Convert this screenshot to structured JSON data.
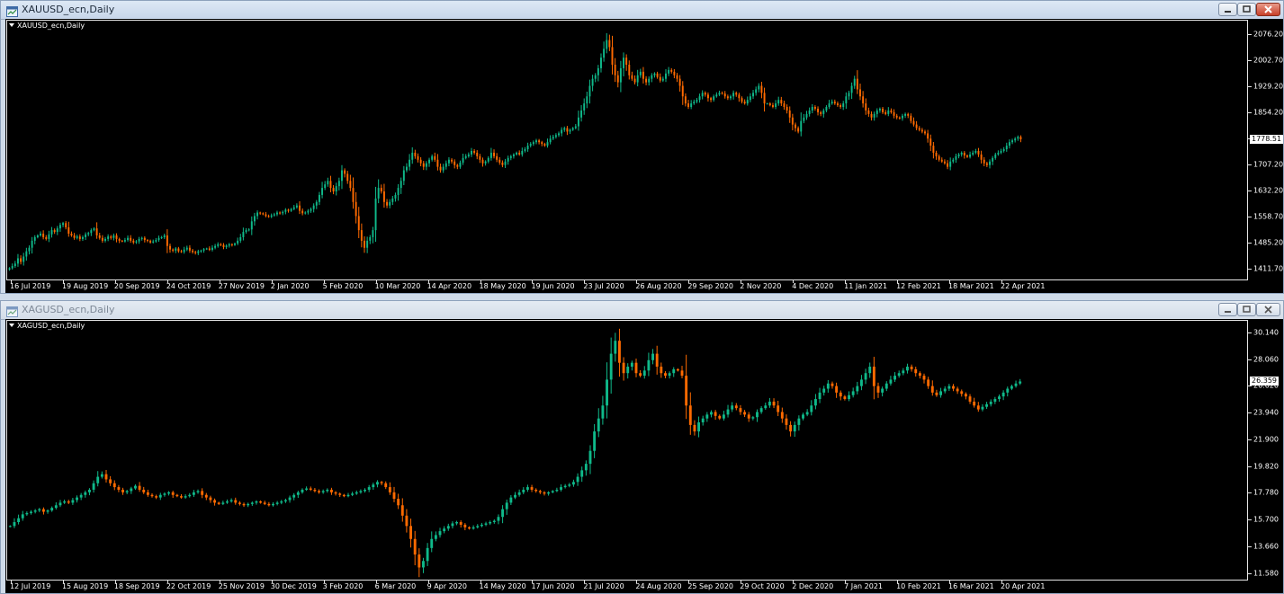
{
  "windows": [
    {
      "title": "XAUUSD_ecn,Daily",
      "symbol_label": "XAUUSD_ecn,Daily",
      "current_price": "1778.51",
      "colors": {
        "up": "#0fb98a",
        "down": "#ff6a00",
        "background": "#000000"
      },
      "chart_data": {
        "type": "candlestick",
        "title": "XAUUSD_ecn,Daily",
        "ylim": [
          1385,
          2110
        ],
        "y_ticks": [
          "2076.20",
          "2002.70",
          "1929.20",
          "1854.20",
          "1779.70",
          "1707.20",
          "1632.20",
          "1558.70",
          "1485.20",
          "1411.70"
        ],
        "y_tick_values": [
          2076.2,
          2002.7,
          1929.2,
          1854.2,
          1779.7,
          1707.2,
          1632.2,
          1558.7,
          1485.2,
          1411.7
        ],
        "x_ticks": [
          "16 Jul 2019",
          "19 Aug 2019",
          "20 Sep 2019",
          "24 Oct 2019",
          "27 Nov 2019",
          "2 Jan 2020",
          "5 Feb 2020",
          "10 Mar 2020",
          "14 Apr 2020",
          "18 May 2020",
          "19 Jun 2020",
          "23 Jul 2020",
          "26 Aug 2020",
          "29 Sep 2020",
          "2 Nov 2020",
          "4 Dec 2020",
          "11 Jan 2021",
          "12 Feb 2021",
          "18 Mar 2021",
          "22 Apr 2021"
        ],
        "series": [
          {
            "values": [
              1412,
              1418,
              1425,
              1440,
              1430,
              1445,
              1460,
              1470,
              1490,
              1500,
              1505,
              1510,
              1500,
              1495,
              1508,
              1520,
              1515,
              1525,
              1535,
              1540,
              1528,
              1510,
              1505,
              1498,
              1502,
              1495,
              1500,
              1508,
              1512,
              1520,
              1525,
              1505,
              1498,
              1490,
              1495,
              1502,
              1498,
              1505,
              1495,
              1490,
              1488,
              1492,
              1498,
              1490,
              1485,
              1488,
              1495,
              1498,
              1492,
              1490,
              1485,
              1488,
              1492,
              1498,
              1500,
              1505,
              1475,
              1465,
              1462,
              1468,
              1460,
              1458,
              1465,
              1470,
              1462,
              1458,
              1455,
              1460,
              1462,
              1466,
              1468,
              1464,
              1470,
              1475,
              1480,
              1478,
              1472,
              1476,
              1480,
              1478,
              1482,
              1490,
              1500,
              1515,
              1520,
              1522,
              1545,
              1560,
              1570,
              1568,
              1565,
              1560,
              1558,
              1562,
              1565,
              1570,
              1568,
              1572,
              1578,
              1575,
              1580,
              1585,
              1590,
              1575,
              1568,
              1570,
              1575,
              1580,
              1590,
              1600,
              1620,
              1640,
              1650,
              1660,
              1640,
              1630,
              1645,
              1660,
              1690,
              1680,
              1660,
              1640,
              1600,
              1560,
              1520,
              1490,
              1470,
              1490,
              1500,
              1520,
              1610,
              1640,
              1630,
              1600,
              1590,
              1600,
              1610,
              1620,
              1640,
              1660,
              1690,
              1700,
              1720,
              1740,
              1730,
              1720,
              1710,
              1700,
              1710,
              1720,
              1730,
              1720,
              1700,
              1690,
              1700,
              1710,
              1720,
              1715,
              1705,
              1700,
              1712,
              1725,
              1730,
              1735,
              1745,
              1740,
              1730,
              1720,
              1710,
              1715,
              1725,
              1740,
              1730,
              1720,
              1712,
              1705,
              1715,
              1725,
              1730,
              1735,
              1740,
              1735,
              1745,
              1750,
              1760,
              1765,
              1770,
              1775,
              1770,
              1765,
              1760,
              1770,
              1780,
              1785,
              1790,
              1795,
              1805,
              1810,
              1800,
              1805,
              1810,
              1815,
              1840,
              1860,
              1880,
              1900,
              1930,
              1950,
              1960,
              1980,
              2010,
              2035,
              2060,
              2040,
              1990,
              1960,
              1940,
              1980,
              2010,
              1990,
              1960,
              1950,
              1940,
              1960,
              1970,
              1950,
              1940,
              1950,
              1960,
              1965,
              1955,
              1945,
              1950,
              1965,
              1975,
              1970,
              1960,
              1950,
              1930,
              1900,
              1880,
              1870,
              1880,
              1885,
              1890,
              1900,
              1910,
              1905,
              1895,
              1890,
              1900,
              1905,
              1910,
              1908,
              1900,
              1895,
              1900,
              1910,
              1905,
              1895,
              1885,
              1880,
              1890,
              1900,
              1910,
              1920,
              1930,
              1910,
              1880,
              1880,
              1875,
              1870,
              1880,
              1890,
              1880,
              1870,
              1860,
              1840,
              1820,
              1810,
              1800,
              1830,
              1840,
              1850,
              1860,
              1870,
              1865,
              1855,
              1850,
              1860,
              1870,
              1880,
              1885,
              1880,
              1875,
              1870,
              1880,
              1900,
              1910,
              1930,
              1950,
              1920,
              1900,
              1880,
              1860,
              1850,
              1840,
              1850,
              1860,
              1865,
              1855,
              1850,
              1860,
              1855,
              1845,
              1840,
              1838,
              1845,
              1850,
              1845,
              1830,
              1820,
              1810,
              1805,
              1800,
              1795,
              1780,
              1760,
              1740,
              1730,
              1720,
              1715,
              1710,
              1700,
              1715,
              1720,
              1730,
              1735,
              1740,
              1732,
              1728,
              1735,
              1740,
              1745,
              1735,
              1720,
              1710,
              1705,
              1715,
              1725,
              1735,
              1740,
              1745,
              1750,
              1760,
              1770,
              1775,
              1780,
              1785,
              1778
            ]
          }
        ]
      }
    },
    {
      "title": "XAGUSD_ecn,Daily",
      "symbol_label": "XAGUSD_ecn,Daily",
      "current_price": "26.359",
      "colors": {
        "up": "#0fb98a",
        "down": "#ff6a00",
        "background": "#000000"
      },
      "chart_data": {
        "type": "candlestick",
        "title": "XAGUSD_ecn,Daily",
        "ylim": [
          11.2,
          30.9
        ],
        "y_ticks": [
          "30.140",
          "28.060",
          "26.020",
          "23.940",
          "21.900",
          "19.820",
          "17.780",
          "15.700",
          "13.660",
          "11.580"
        ],
        "y_tick_values": [
          30.14,
          28.06,
          26.02,
          23.94,
          21.9,
          19.82,
          17.78,
          15.7,
          13.66,
          11.58
        ],
        "x_ticks": [
          "12 Jul 2019",
          "15 Aug 2019",
          "18 Sep 2019",
          "22 Oct 2019",
          "25 Nov 2019",
          "30 Dec 2019",
          "3 Feb 2020",
          "6 Mar 2020",
          "9 Apr 2020",
          "14 May 2020",
          "17 Jun 2020",
          "21 Jul 2020",
          "24 Aug 2020",
          "25 Sep 2020",
          "29 Oct 2020",
          "2 Dec 2020",
          "7 Jan 2021",
          "10 Feb 2021",
          "16 Mar 2021",
          "20 Apr 2021"
        ],
        "series": [
          {
            "values": [
              15.2,
              15.5,
              15.8,
              16.1,
              16.2,
              16.3,
              16.4,
              16.5,
              16.3,
              16.4,
              16.6,
              16.8,
              17.0,
              17.1,
              17.0,
              17.2,
              17.4,
              17.6,
              17.8,
              18.0,
              18.5,
              19.0,
              19.2,
              18.8,
              18.5,
              18.2,
              18.0,
              17.8,
              17.9,
              18.1,
              18.3,
              18.0,
              17.8,
              17.6,
              17.5,
              17.4,
              17.6,
              17.7,
              17.8,
              17.6,
              17.5,
              17.4,
              17.5,
              17.6,
              17.8,
              17.9,
              17.6,
              17.4,
              17.2,
              17.0,
              16.9,
              17.0,
              17.1,
              17.2,
              17.0,
              16.9,
              16.8,
              16.9,
              17.0,
              17.1,
              17.0,
              16.9,
              16.8,
              16.9,
              17.0,
              17.1,
              17.2,
              17.4,
              17.6,
              17.8,
              18.0,
              18.1,
              18.0,
              17.9,
              17.8,
              17.9,
              18.0,
              17.8,
              17.7,
              17.6,
              17.5,
              17.6,
              17.7,
              17.8,
              17.9,
              18.0,
              18.2,
              18.4,
              18.6,
              18.5,
              18.2,
              17.8,
              17.3,
              16.8,
              16.0,
              15.2,
              14.2,
              13.0,
              12.0,
              12.5,
              13.5,
              14.2,
              14.5,
              14.8,
              15.0,
              15.2,
              15.4,
              15.5,
              15.3,
              15.1,
              15.0,
              15.1,
              15.2,
              15.3,
              15.4,
              15.5,
              15.6,
              15.9,
              16.5,
              17.0,
              17.4,
              17.6,
              17.8,
              18.0,
              18.2,
              18.0,
              17.9,
              17.8,
              17.7,
              17.8,
              17.9,
              18.0,
              18.2,
              18.3,
              18.4,
              18.6,
              19.0,
              19.5,
              20.0,
              21.0,
              22.5,
              23.5,
              24.5,
              26.5,
              28.5,
              29.5,
              27.8,
              27.0,
              27.5,
              27.8,
              27.0,
              26.8,
              27.2,
              28.0,
              28.5,
              27.5,
              27.0,
              26.8,
              27.0,
              27.3,
              27.2,
              26.8,
              24.5,
              23.0,
              22.5,
              23.2,
              23.5,
              23.8,
              24.0,
              23.7,
              23.5,
              23.8,
              24.2,
              24.5,
              24.3,
              24.0,
              23.8,
              23.5,
              23.6,
              24.0,
              24.3,
              24.5,
              24.8,
              24.5,
              24.0,
              23.5,
              23.0,
              22.5,
              23.0,
              23.5,
              23.8,
              24.0,
              24.5,
              25.0,
              25.5,
              25.8,
              26.2,
              26.0,
              25.5,
              25.2,
              25.0,
              25.3,
              25.6,
              26.0,
              26.5,
              27.0,
              27.5,
              26.0,
              25.5,
              25.8,
              26.2,
              26.5,
              26.8,
              27.0,
              27.2,
              27.5,
              27.3,
              27.0,
              26.8,
              26.5,
              26.0,
              25.5,
              25.3,
              25.6,
              25.8,
              26.0,
              25.8,
              25.6,
              25.4,
              25.2,
              24.8,
              24.5,
              24.2,
              24.4,
              24.6,
              24.8,
              25.0,
              25.2,
              25.5,
              25.8,
              26.0,
              26.2,
              26.359
            ]
          }
        ]
      }
    }
  ]
}
